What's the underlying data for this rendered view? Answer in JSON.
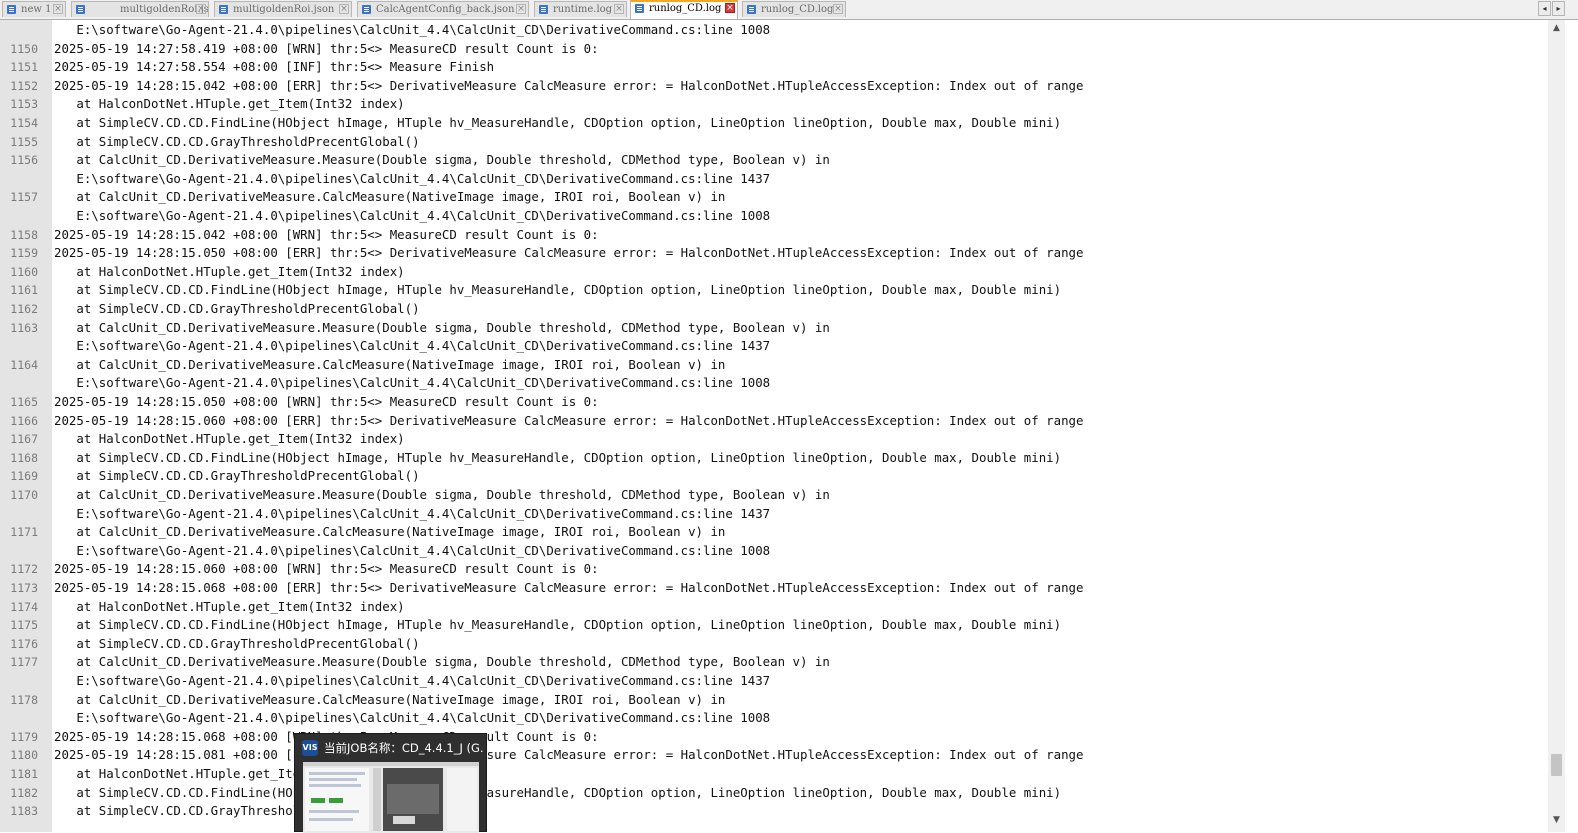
{
  "tabs": [
    {
      "label": "new  1",
      "active": false
    },
    {
      "label": "multigoldenRoi.json",
      "active": false
    },
    {
      "label": "multigoldenRoi.json",
      "active": false
    },
    {
      "label": "CalcAgentConfig_back.json",
      "active": false
    },
    {
      "label": "runtime.log",
      "active": false
    },
    {
      "label": "runlog_CD.log",
      "active": true
    },
    {
      "label": "runlog_CD.log",
      "active": false
    }
  ],
  "tab_nav": {
    "prev": "◂",
    "next": "▸"
  },
  "tab_close_glyph": "×",
  "scroll": {
    "up": "▲",
    "down": "▼"
  },
  "lines": [
    {
      "num": "",
      "text": "   E:\\software\\Go-Agent-21.4.0\\pipelines\\CalcUnit_4.4\\CalcUnit_CD\\DerivativeCommand.cs:line 1008"
    },
    {
      "num": "1150",
      "text": "2025-05-19 14:27:58.419 +08:00 [WRN] thr:5<> MeasureCD result Count is 0:"
    },
    {
      "num": "1151",
      "text": "2025-05-19 14:27:58.554 +08:00 [INF] thr:5<> Measure Finish"
    },
    {
      "num": "1152",
      "text": "2025-05-19 14:28:15.042 +08:00 [ERR] thr:5<> DerivativeMeasure CalcMeasure error: = HalconDotNet.HTupleAccessException: Index out of range"
    },
    {
      "num": "1153",
      "text": "   at HalconDotNet.HTuple.get_Item(Int32 index)"
    },
    {
      "num": "1154",
      "text": "   at SimpleCV.CD.CD.FindLine(HObject hImage, HTuple hv_MeasureHandle, CDOption option, LineOption lineOption, Double max, Double mini)"
    },
    {
      "num": "1155",
      "text": "   at SimpleCV.CD.CD.GrayThresholdPrecentGlobal()"
    },
    {
      "num": "1156",
      "text": "   at CalcUnit_CD.DerivativeMeasure.Measure(Double sigma, Double threshold, CDMethod type, Boolean v) in"
    },
    {
      "num": "",
      "text": "   E:\\software\\Go-Agent-21.4.0\\pipelines\\CalcUnit_4.4\\CalcUnit_CD\\DerivativeCommand.cs:line 1437"
    },
    {
      "num": "1157",
      "text": "   at CalcUnit_CD.DerivativeMeasure.CalcMeasure(NativeImage image, IROI roi, Boolean v) in"
    },
    {
      "num": "",
      "text": "   E:\\software\\Go-Agent-21.4.0\\pipelines\\CalcUnit_4.4\\CalcUnit_CD\\DerivativeCommand.cs:line 1008"
    },
    {
      "num": "1158",
      "text": "2025-05-19 14:28:15.042 +08:00 [WRN] thr:5<> MeasureCD result Count is 0:"
    },
    {
      "num": "1159",
      "text": "2025-05-19 14:28:15.050 +08:00 [ERR] thr:5<> DerivativeMeasure CalcMeasure error: = HalconDotNet.HTupleAccessException: Index out of range"
    },
    {
      "num": "1160",
      "text": "   at HalconDotNet.HTuple.get_Item(Int32 index)"
    },
    {
      "num": "1161",
      "text": "   at SimpleCV.CD.CD.FindLine(HObject hImage, HTuple hv_MeasureHandle, CDOption option, LineOption lineOption, Double max, Double mini)"
    },
    {
      "num": "1162",
      "text": "   at SimpleCV.CD.CD.GrayThresholdPrecentGlobal()"
    },
    {
      "num": "1163",
      "text": "   at CalcUnit_CD.DerivativeMeasure.Measure(Double sigma, Double threshold, CDMethod type, Boolean v) in"
    },
    {
      "num": "",
      "text": "   E:\\software\\Go-Agent-21.4.0\\pipelines\\CalcUnit_4.4\\CalcUnit_CD\\DerivativeCommand.cs:line 1437"
    },
    {
      "num": "1164",
      "text": "   at CalcUnit_CD.DerivativeMeasure.CalcMeasure(NativeImage image, IROI roi, Boolean v) in"
    },
    {
      "num": "",
      "text": "   E:\\software\\Go-Agent-21.4.0\\pipelines\\CalcUnit_4.4\\CalcUnit_CD\\DerivativeCommand.cs:line 1008"
    },
    {
      "num": "1165",
      "text": "2025-05-19 14:28:15.050 +08:00 [WRN] thr:5<> MeasureCD result Count is 0:"
    },
    {
      "num": "1166",
      "text": "2025-05-19 14:28:15.060 +08:00 [ERR] thr:5<> DerivativeMeasure CalcMeasure error: = HalconDotNet.HTupleAccessException: Index out of range"
    },
    {
      "num": "1167",
      "text": "   at HalconDotNet.HTuple.get_Item(Int32 index)"
    },
    {
      "num": "1168",
      "text": "   at SimpleCV.CD.CD.FindLine(HObject hImage, HTuple hv_MeasureHandle, CDOption option, LineOption lineOption, Double max, Double mini)"
    },
    {
      "num": "1169",
      "text": "   at SimpleCV.CD.CD.GrayThresholdPrecentGlobal()"
    },
    {
      "num": "1170",
      "text": "   at CalcUnit_CD.DerivativeMeasure.Measure(Double sigma, Double threshold, CDMethod type, Boolean v) in"
    },
    {
      "num": "",
      "text": "   E:\\software\\Go-Agent-21.4.0\\pipelines\\CalcUnit_4.4\\CalcUnit_CD\\DerivativeCommand.cs:line 1437"
    },
    {
      "num": "1171",
      "text": "   at CalcUnit_CD.DerivativeMeasure.CalcMeasure(NativeImage image, IROI roi, Boolean v) in"
    },
    {
      "num": "",
      "text": "   E:\\software\\Go-Agent-21.4.0\\pipelines\\CalcUnit_4.4\\CalcUnit_CD\\DerivativeCommand.cs:line 1008"
    },
    {
      "num": "1172",
      "text": "2025-05-19 14:28:15.060 +08:00 [WRN] thr:5<> MeasureCD result Count is 0:"
    },
    {
      "num": "1173",
      "text": "2025-05-19 14:28:15.068 +08:00 [ERR] thr:5<> DerivativeMeasure CalcMeasure error: = HalconDotNet.HTupleAccessException: Index out of range"
    },
    {
      "num": "1174",
      "text": "   at HalconDotNet.HTuple.get_Item(Int32 index)"
    },
    {
      "num": "1175",
      "text": "   at SimpleCV.CD.CD.FindLine(HObject hImage, HTuple hv_MeasureHandle, CDOption option, LineOption lineOption, Double max, Double mini)"
    },
    {
      "num": "1176",
      "text": "   at SimpleCV.CD.CD.GrayThresholdPrecentGlobal()"
    },
    {
      "num": "1177",
      "text": "   at CalcUnit_CD.DerivativeMeasure.Measure(Double sigma, Double threshold, CDMethod type, Boolean v) in"
    },
    {
      "num": "",
      "text": "   E:\\software\\Go-Agent-21.4.0\\pipelines\\CalcUnit_4.4\\CalcUnit_CD\\DerivativeCommand.cs:line 1437"
    },
    {
      "num": "1178",
      "text": "   at CalcUnit_CD.DerivativeMeasure.CalcMeasure(NativeImage image, IROI roi, Boolean v) in"
    },
    {
      "num": "",
      "text": "   E:\\software\\Go-Agent-21.4.0\\pipelines\\CalcUnit_4.4\\CalcUnit_CD\\DerivativeCommand.cs:line 1008"
    },
    {
      "num": "1179",
      "text": "2025-05-19 14:28:15.068 +08:00 [WRN] thr:5<> MeasureCD result Count is 0:"
    },
    {
      "num": "1180",
      "text": "2025-05-19 14:28:15.081 +08:00 [ERR] thr:5<> DerivativeMeasure CalcMeasure error: = HalconDotNet.HTupleAccessException: Index out of range"
    },
    {
      "num": "1181",
      "text": "   at HalconDotNet.HTuple.get_Item(Int32 index)"
    },
    {
      "num": "1182",
      "text": "   at SimpleCV.CD.CD.FindLine(HObject hImage, HTuple hv_MeasureHandle, CDOption option, LineOption lineOption, Double max, Double mini)"
    },
    {
      "num": "1183",
      "text": "   at SimpleCV.CD.CD.GrayThresholdPrecentGlobal()"
    }
  ],
  "popup": {
    "app_icon": "VIS",
    "title": "当前JOB名称：CD_4.4.1_J (G..."
  },
  "colors": {
    "active_tab_accent": "#f5a623",
    "tab_close_active": "#d23b3b",
    "doc_icon": "#3b73c4"
  }
}
